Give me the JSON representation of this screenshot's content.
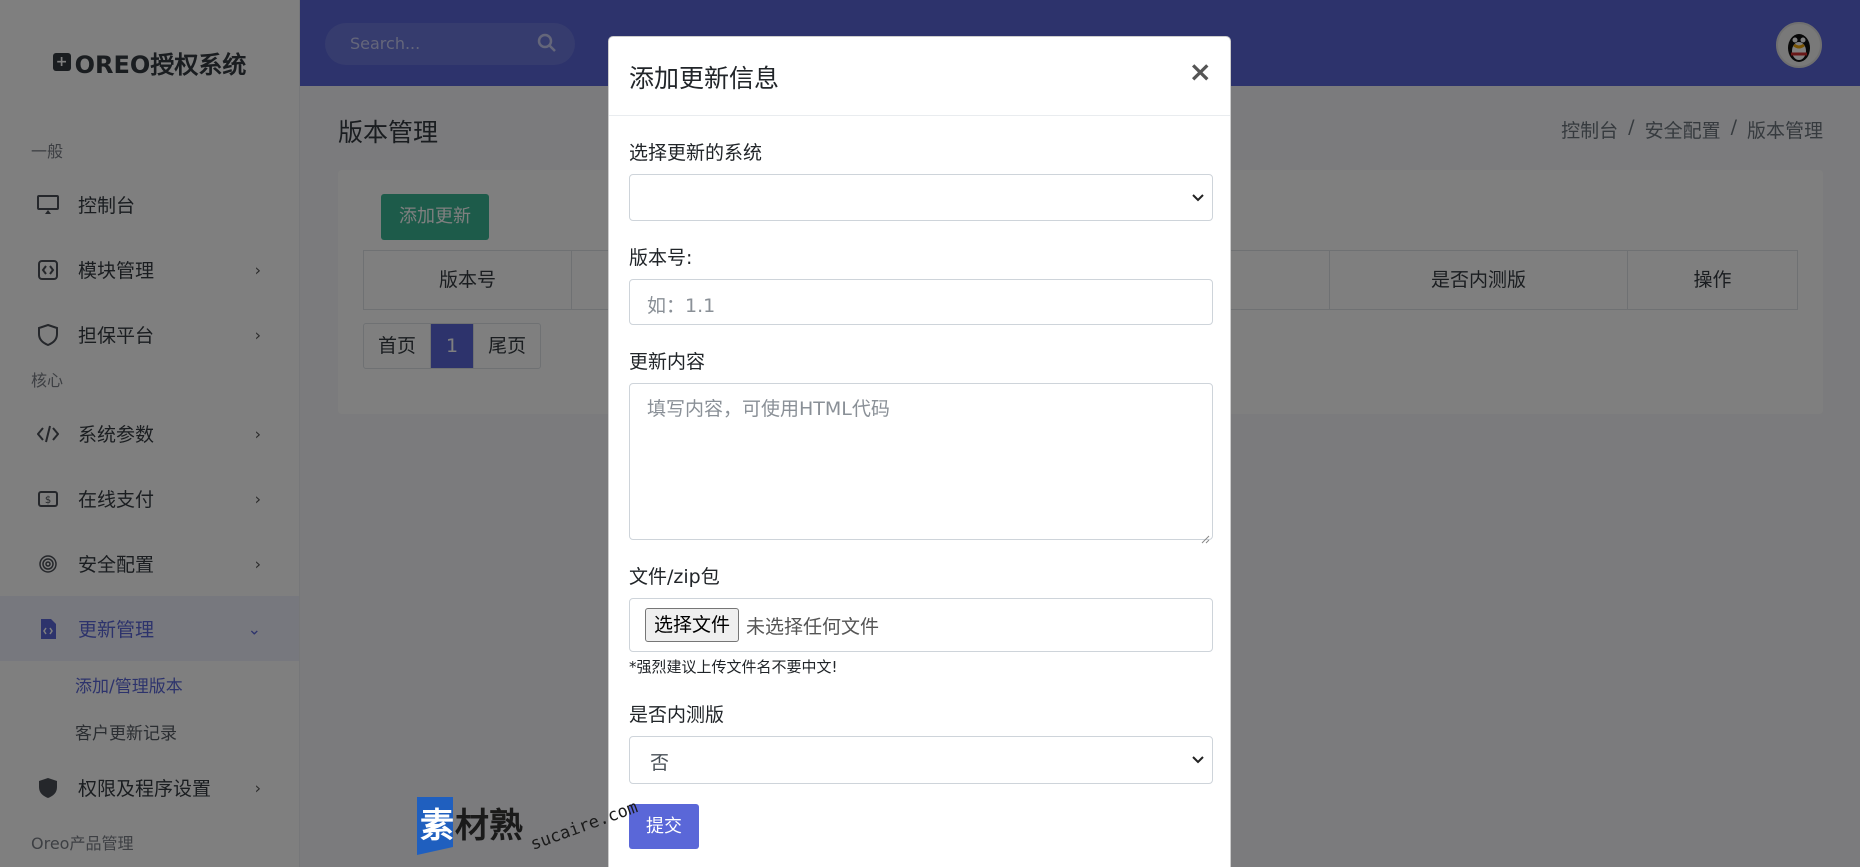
{
  "brand": {
    "name": "OREO授权系统",
    "icon": "plus-square-icon"
  },
  "sidebar": {
    "sections": [
      "一般",
      "核心"
    ],
    "items": [
      {
        "label": "控制台",
        "icon": "monitor-icon",
        "chevron": false
      },
      {
        "label": "模块管理",
        "icon": "code-square-icon",
        "chevron": true
      },
      {
        "label": "担保平台",
        "icon": "shield-icon",
        "chevron": true
      },
      {
        "label": "系统参数",
        "icon": "code-icon",
        "chevron": true
      },
      {
        "label": "在线支付",
        "icon": "dollar-icon",
        "chevron": true
      },
      {
        "label": "安全配置",
        "icon": "fingerprint-icon",
        "chevron": true
      },
      {
        "label": "更新管理",
        "icon": "file-code-icon",
        "chevron": true,
        "active": true
      },
      {
        "label": "权限及程序设置",
        "icon": "shield-filled-icon",
        "chevron": true
      }
    ],
    "sub_items": [
      "添加/管理版本",
      "客户更新记录"
    ],
    "cut_off_item": "Oreo产品管理"
  },
  "topbar": {
    "search_placeholder": "Search..."
  },
  "page": {
    "title": "版本管理",
    "breadcrumb": [
      "控制台",
      "安全配置",
      "版本管理"
    ],
    "add_button": "添加更新",
    "table_headers": [
      "版本号",
      "",
      "是否内测版",
      "操作"
    ],
    "pager": [
      "首页",
      "1",
      "尾页"
    ]
  },
  "modal": {
    "title": "添加更新信息",
    "close": "×",
    "system_label": "选择更新的系统",
    "system_value": "",
    "version_label": "版本号:",
    "version_placeholder": "如：1.1",
    "content_label": "更新内容",
    "content_placeholder": "填写内容，可使用HTML代码",
    "file_label": "文件/zip包",
    "file_button": "选择文件",
    "file_status": "未选择任何文件",
    "file_hint": "*强烈建议上传文件名不要中文!",
    "beta_label": "是否内测版",
    "beta_value": "否",
    "submit": "提交"
  },
  "watermark": {
    "text_cn": "素材熟",
    "text_en": "sucaire.com"
  },
  "colors": {
    "primary": "#5a67d8",
    "success": "#3ab795",
    "overlay": "rgba(0,0,0,0.5)"
  }
}
